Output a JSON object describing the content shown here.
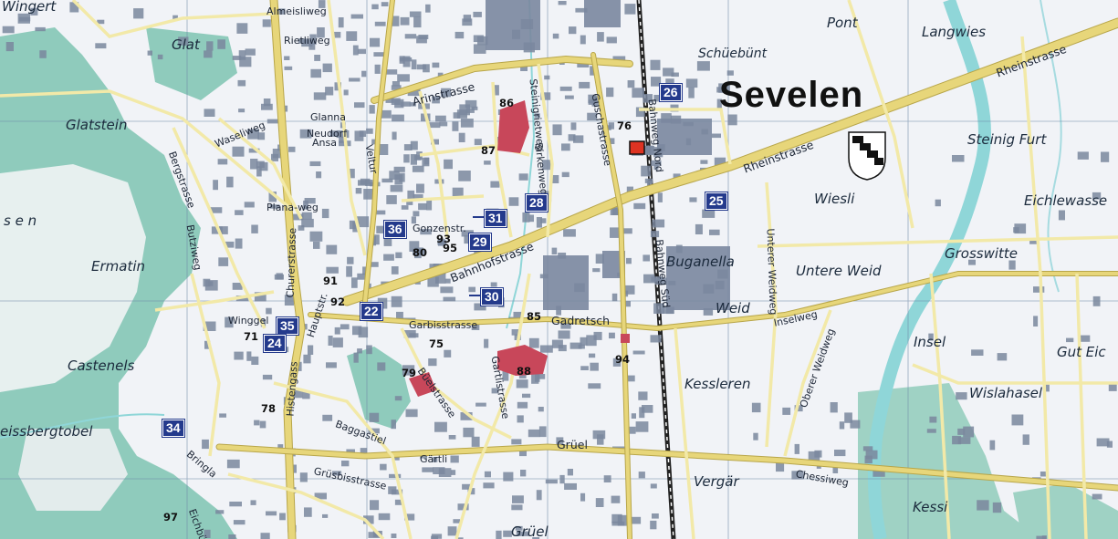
{
  "map": {
    "town_name": "Sevelen",
    "places": [
      {
        "id": "wingert",
        "text": "Wingert"
      },
      {
        "id": "glat",
        "text": "Glat"
      },
      {
        "id": "glatstein",
        "text": "Glatstein"
      },
      {
        "id": "sen",
        "text": "s e n"
      },
      {
        "id": "ermatin",
        "text": "Ermatin"
      },
      {
        "id": "castenels",
        "text": "Castenels"
      },
      {
        "id": "eissbergtobel",
        "text": "eissbergtobel"
      },
      {
        "id": "pont",
        "text": "Pont"
      },
      {
        "id": "langwies",
        "text": "Langwies"
      },
      {
        "id": "schuebuent",
        "text": "Schüebünt"
      },
      {
        "id": "steinig-furt",
        "text": "Steinig Furt"
      },
      {
        "id": "eichlewasse",
        "text": "Eichlewasse"
      },
      {
        "id": "wiesli",
        "text": "Wiesli"
      },
      {
        "id": "grosswitte",
        "text": "Grosswitte"
      },
      {
        "id": "buganella",
        "text": "Buganella"
      },
      {
        "id": "untere-weid",
        "text": "Untere Weid"
      },
      {
        "id": "weid",
        "text": "Weid"
      },
      {
        "id": "insel",
        "text": "Insel"
      },
      {
        "id": "gut-eic",
        "text": "Gut Eic"
      },
      {
        "id": "kessleren",
        "text": "Kessleren"
      },
      {
        "id": "wislahasel",
        "text": "Wislahasel"
      },
      {
        "id": "vergaer",
        "text": "Vergär"
      },
      {
        "id": "kessi",
        "text": "Kessi"
      },
      {
        "id": "grueel-bottom",
        "text": "Grüel"
      }
    ],
    "streets": [
      {
        "id": "rheinstrasse-1",
        "text": "Rheinstrasse"
      },
      {
        "id": "rheinstrasse-2",
        "text": "Rheinstrasse"
      },
      {
        "id": "bahnhofstrasse",
        "text": "Bahnhofstrasse"
      },
      {
        "id": "arinstrasse",
        "text": "Arinstrasse"
      },
      {
        "id": "gadretsch",
        "text": "Gadretsch"
      },
      {
        "id": "garbisstrasse",
        "text": "Garbisstrasse"
      },
      {
        "id": "grueel-road",
        "text": "Grüel"
      },
      {
        "id": "gaertli",
        "text": "Gärtli"
      },
      {
        "id": "bergstrasse",
        "text": "Bergstrasse"
      },
      {
        "id": "waseliweg",
        "text": "Waseliweg"
      },
      {
        "id": "rietliweg",
        "text": "Rietliweg"
      },
      {
        "id": "hauptstr",
        "text": "Hauptstr."
      },
      {
        "id": "veltur",
        "text": "Veltur"
      },
      {
        "id": "gruenbisstrasse",
        "text": "Grüsbisstrasse"
      },
      {
        "id": "baggastiel",
        "text": "Baggastiel"
      },
      {
        "id": "hinterdorf",
        "text": "Histengass"
      },
      {
        "id": "guschastrasse",
        "text": "Guschastrasse"
      },
      {
        "id": "inselweg",
        "text": "Inselweg"
      },
      {
        "id": "chessiweg",
        "text": "Chessiweg"
      },
      {
        "id": "bahnweg-nord",
        "text": "Bahnweg Nord"
      },
      {
        "id": "bahnweg-sued",
        "text": "Bahnweg Süd"
      },
      {
        "id": "unterer-weidweg",
        "text": "Unterer Weidweg"
      },
      {
        "id": "oberer-weidweg",
        "text": "Oberer Weidweg"
      },
      {
        "id": "almeisliweg",
        "text": "Almeisliweg"
      },
      {
        "id": "winggel",
        "text": "Winggel"
      },
      {
        "id": "churerstrasse",
        "text": "Churerstrasse"
      },
      {
        "id": "buechstrasse",
        "text": "Büelstrasse"
      },
      {
        "id": "gartlistrasse",
        "text": "Gartlistrasse"
      },
      {
        "id": "gonzenstr",
        "text": "Gonzenstr."
      },
      {
        "id": "birkenweg",
        "text": "Birkenweg"
      },
      {
        "id": "steinigrietweg",
        "text": "Steinigrietweg"
      },
      {
        "id": "neudorf",
        "text": "Neudorf"
      },
      {
        "id": "glanna",
        "text": "Glanna"
      },
      {
        "id": "ansa",
        "text": "Ansa"
      },
      {
        "id": "planaweg",
        "text": "Plana-weg"
      },
      {
        "id": "butziweg",
        "text": "Butziweg"
      },
      {
        "id": "eichbuehl",
        "text": "Eichbühl"
      },
      {
        "id": "bringla",
        "text": "Bringla"
      }
    ],
    "route_markers": [
      "26",
      "25",
      "28",
      "31",
      "29",
      "30",
      "36",
      "22",
      "35",
      "24",
      "34"
    ],
    "poi_numbers": [
      "86",
      "87",
      "76",
      "93",
      "80",
      "95",
      "91",
      "92",
      "85",
      "75",
      "71",
      "88",
      "94",
      "79",
      "78",
      "97"
    ],
    "colors": {
      "main_road": "#e7d67a",
      "minor_road": "#f2e9a8",
      "forest": "#8fcbbc",
      "water": "#8fd6d8",
      "building": "#7a879e",
      "public_building": "#c8475a",
      "marker_blue": "#243a8c",
      "grid_line": "#6f8aa8"
    }
  }
}
